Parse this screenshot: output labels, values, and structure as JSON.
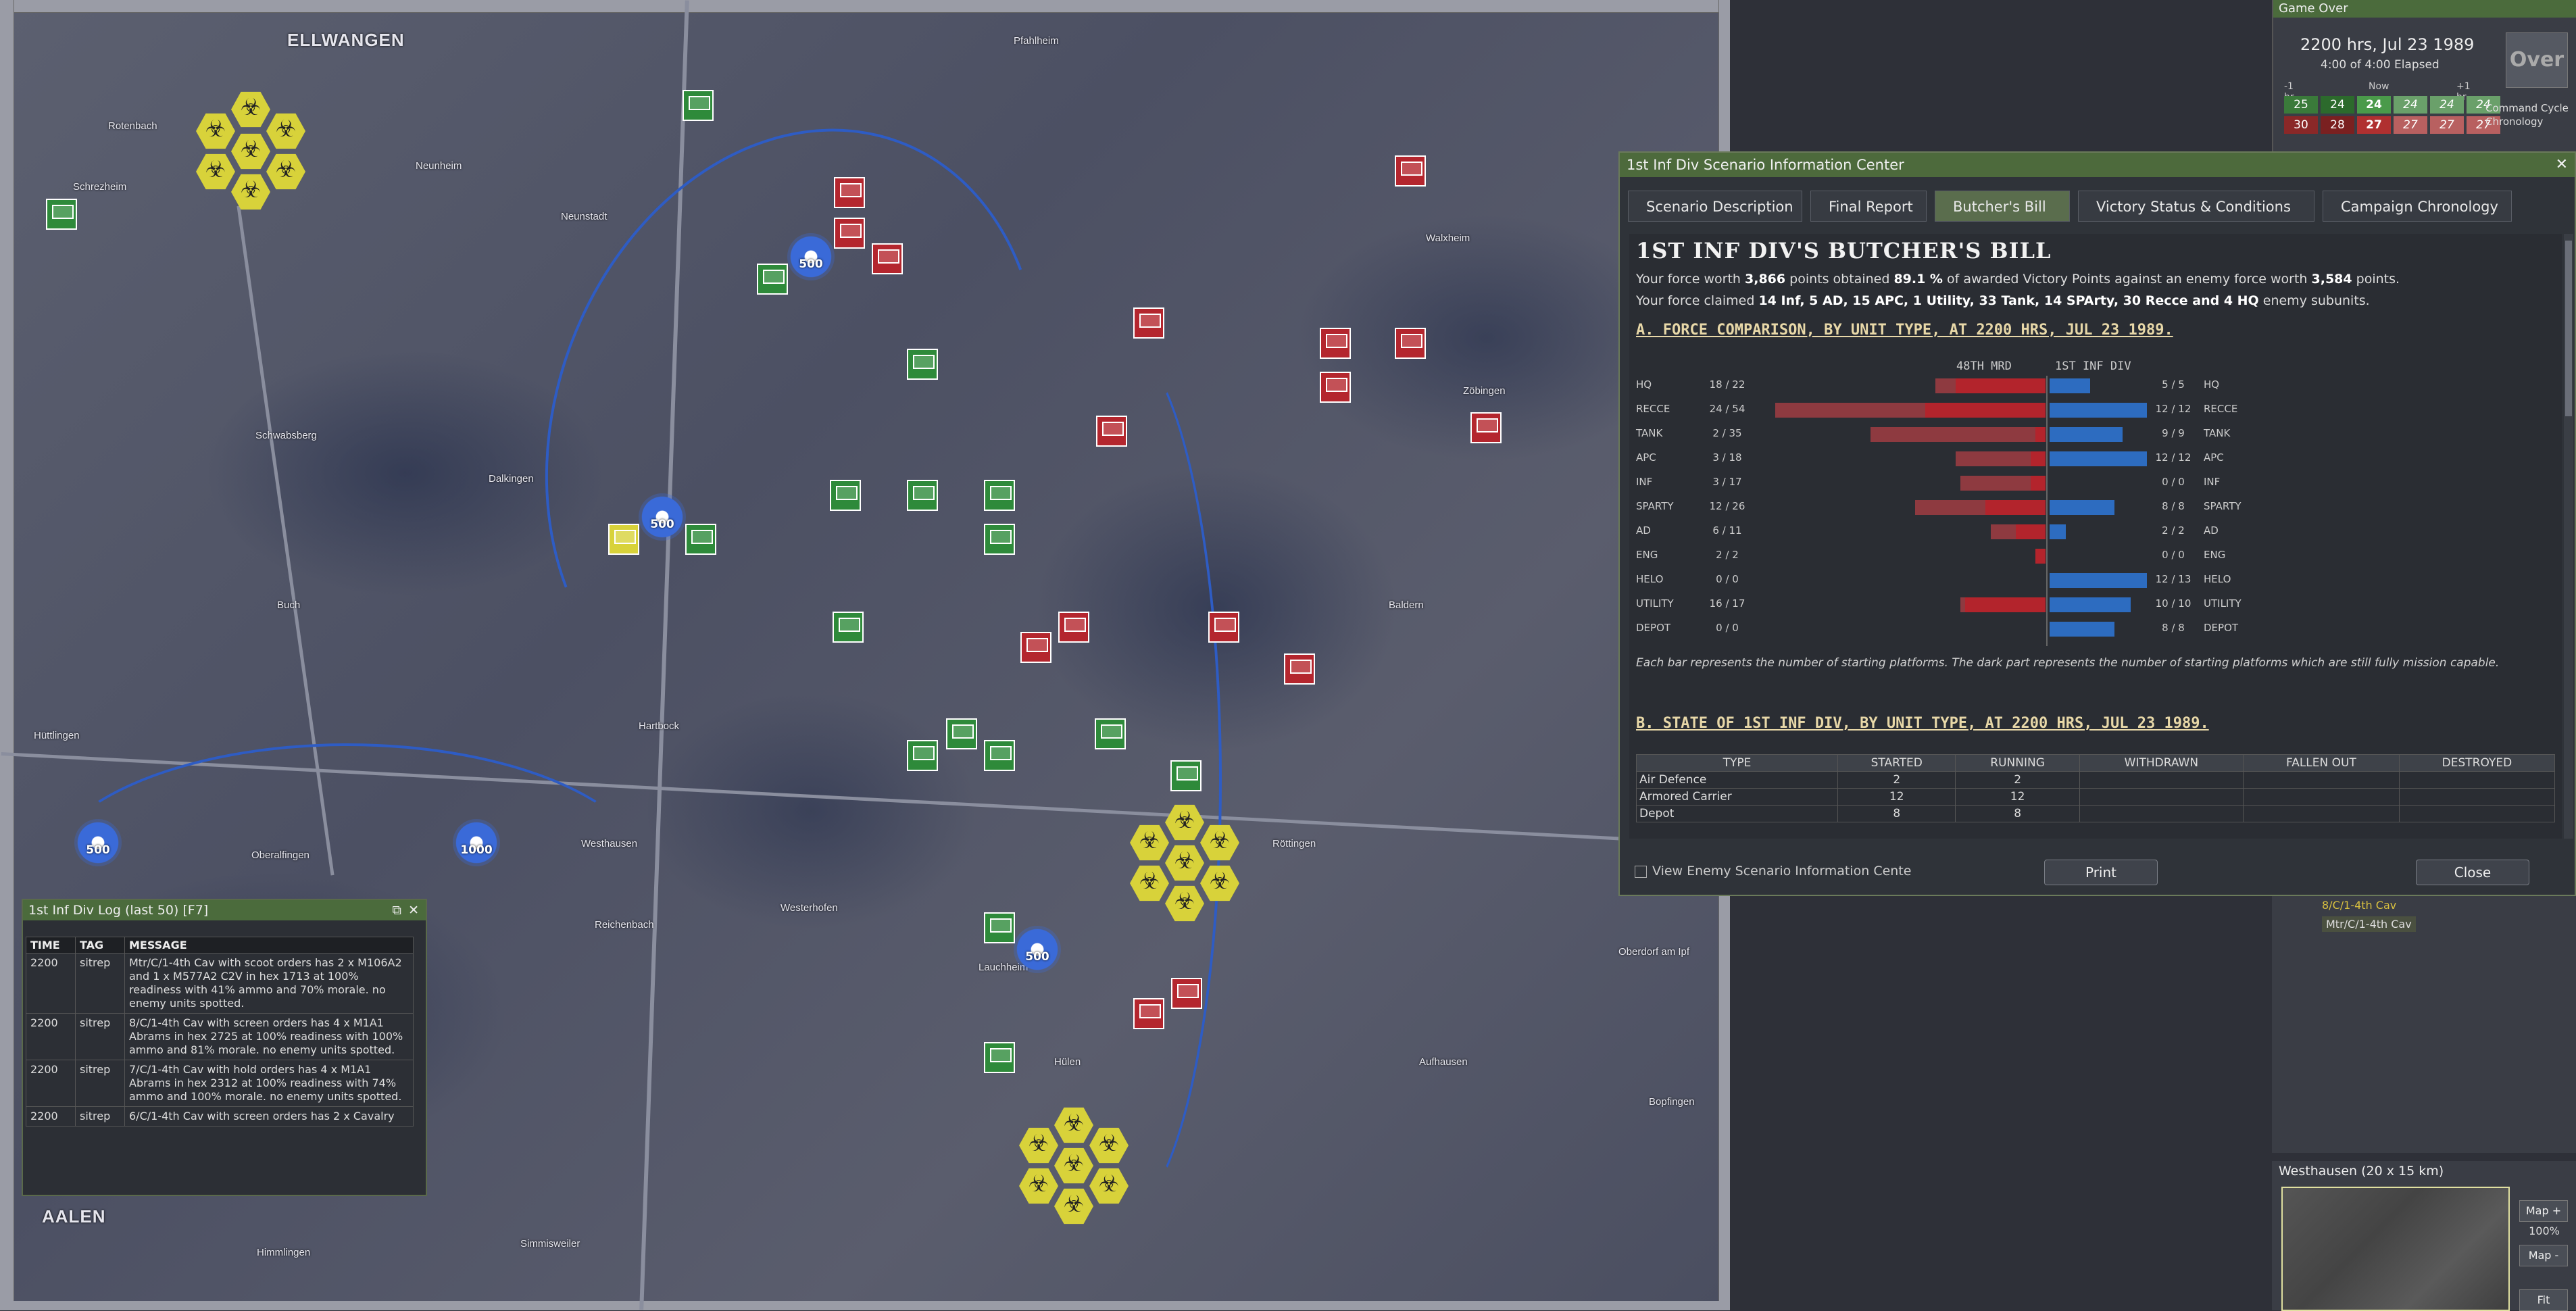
{
  "map": {
    "towns": [
      "ELLWANGEN",
      "Rotenbach",
      "Schrezheim",
      "Neunheim",
      "Neunstadt",
      "Pfahlheim",
      "Walxheim",
      "Zöbingen",
      "Schwabsberg",
      "Dalkingen",
      "Buch",
      "Hüttlingen",
      "Oberalfingen",
      "Hartbock",
      "Westhausen",
      "Reichenbach",
      "Westerhofen",
      "Lauchheim",
      "Röttingen",
      "Baldern",
      "Aufhausen",
      "Oberdorf am Ipf",
      "Bopfingen",
      "Hülen",
      "Himmlingen",
      "Simmisweiler",
      "AALEN"
    ],
    "arty": [
      "500",
      "500",
      "500",
      "1000",
      "500",
      "500"
    ],
    "arty_top": "1"
  },
  "game_over": {
    "title": "Game Over",
    "time": "2200 hrs, Jul 23 1989",
    "elapsed": "4:00 of 4:00 Elapsed",
    "over_label": "Over",
    "chron_minus": "-1 hr",
    "chron_now": "Now",
    "chron_plus": "+1 hr",
    "row1": [
      "25",
      "24",
      "24",
      "24",
      "24",
      "24"
    ],
    "row2": [
      "30",
      "28",
      "27",
      "27",
      "27",
      "27"
    ],
    "command_cycle": "Command Cycle",
    "chronology": "Chronology"
  },
  "dialog": {
    "title": "1st Inf Div Scenario Information Center",
    "close_x": "✕",
    "tabs": [
      "Scenario Description",
      "Final Report",
      "Butcher's Bill",
      "Victory Status & Conditions",
      "Campaign Chronology"
    ],
    "heading": "1ST INF DIV'S BUTCHER'S BILL",
    "line1_pre": "Your force worth ",
    "line1_worth": "3,866",
    "line1_mid": " points obtained ",
    "line1_pct": "89.1 %",
    "line1_mid2": " of awarded Victory Points against an enemy force worth ",
    "line1_enemy": "3,584",
    "line1_post": " points.",
    "line2_pre": "Your force claimed ",
    "line2_claim": "14 Inf, 5 AD, 15 APC, 1 Utility, 33 Tank, 14 SPArty, 30 Recce and 4 HQ",
    "line2_post": " enemy subunits.",
    "section_a": "A. FORCE COMPARISON, BY UNIT TYPE, AT 2200 HRS, JUL 23 1989.",
    "col_enemy": "48TH MRD",
    "col_own": "1ST INF DIV",
    "rows": [
      {
        "type": "HQ",
        "enemy": "18 / 22",
        "own": "5 / 5",
        "enemy_total": 22,
        "enemy_live": 18,
        "own_total": 5,
        "own_live": 5
      },
      {
        "type": "RECCE",
        "enemy": "24 / 54",
        "own": "12 / 12",
        "enemy_total": 54,
        "enemy_live": 24,
        "own_total": 12,
        "own_live": 12
      },
      {
        "type": "TANK",
        "enemy": "2 / 35",
        "own": "9 / 9",
        "enemy_total": 35,
        "enemy_live": 2,
        "own_total": 9,
        "own_live": 9
      },
      {
        "type": "APC",
        "enemy": "3 / 18",
        "own": "12 / 12",
        "enemy_total": 18,
        "enemy_live": 3,
        "own_total": 12,
        "own_live": 12
      },
      {
        "type": "INF",
        "enemy": "3 / 17",
        "own": "0 / 0",
        "enemy_total": 17,
        "enemy_live": 3,
        "own_total": 0,
        "own_live": 0
      },
      {
        "type": "SPARTY",
        "enemy": "12 / 26",
        "own": "8 / 8",
        "enemy_total": 26,
        "enemy_live": 12,
        "own_total": 8,
        "own_live": 8
      },
      {
        "type": "AD",
        "enemy": "6 / 11",
        "own": "2 / 2",
        "enemy_total": 11,
        "enemy_live": 6,
        "own_total": 2,
        "own_live": 2
      },
      {
        "type": "ENG",
        "enemy": "2 / 2",
        "own": "0 / 0",
        "enemy_total": 2,
        "enemy_live": 2,
        "own_total": 0,
        "own_live": 0
      },
      {
        "type": "HELO",
        "enemy": "0 / 0",
        "own": "12 / 13",
        "enemy_total": 0,
        "enemy_live": 0,
        "own_total": 13,
        "own_live": 12
      },
      {
        "type": "UTILITY",
        "enemy": "16 / 17",
        "own": "10 / 10",
        "enemy_total": 17,
        "enemy_live": 16,
        "own_total": 10,
        "own_live": 10
      },
      {
        "type": "DEPOT",
        "enemy": "0 / 0",
        "own": "8 / 8",
        "enemy_total": 0,
        "enemy_live": 0,
        "own_total": 8,
        "own_live": 8
      }
    ],
    "note": "Each bar represents the number of starting platforms. The dark part represents the number of starting platforms which are still fully mission capable.",
    "section_b": "B. STATE OF 1ST INF DIV, BY UNIT TYPE, AT 2200 HRS, JUL 23 1989.",
    "state_headers": [
      "TYPE",
      "STARTED",
      "RUNNING",
      "WITHDRAWN",
      "FALLEN OUT",
      "DESTROYED"
    ],
    "state_rows": [
      [
        "Air Defence",
        "2",
        "2",
        "",
        "",
        ""
      ],
      [
        "Armored Carrier",
        "12",
        "12",
        "",
        "",
        ""
      ],
      [
        "Depot",
        "8",
        "8",
        "",
        "",
        ""
      ]
    ],
    "view_enemy": "View Enemy Scenario Information Cente",
    "print": "Print",
    "close": "Close"
  },
  "log": {
    "title": "1st Inf Div Log (last 50)   [F7]",
    "headers": [
      "TIME",
      "TAG",
      "MESSAGE"
    ],
    "rows": [
      [
        "2200",
        "sitrep",
        "Mtr/C/1-4th Cav with scoot orders has 2 x M106A2 and 1 x M577A2 C2V in hex 1713 at 100% readiness with 41% ammo and 70% morale. no enemy units spotted."
      ],
      [
        "2200",
        "sitrep",
        "8/C/1-4th Cav with screen orders has 4 x M1A1 Abrams in hex 2725 at 100% readiness with 100% ammo and 81% morale. no enemy units spotted."
      ],
      [
        "2200",
        "sitrep",
        "7/C/1-4th Cav with hold orders has 4 x M1A1 Abrams in hex 2312 at 100% readiness with 74% ammo and 100% morale. no enemy units spotted."
      ],
      [
        "2200",
        "sitrep",
        "6/C/1-4th Cav with screen orders has 2 x Cavalry"
      ]
    ]
  },
  "units": {
    "entry1": "8/C/1-4th Cav",
    "entry2": "Mtr/C/1-4th Cav"
  },
  "minimap": {
    "title": "Westhausen (20 x 15 km)",
    "map_plus": "Map +",
    "zoom": "100%",
    "map_minus": "Map -",
    "fit": "Fit"
  }
}
